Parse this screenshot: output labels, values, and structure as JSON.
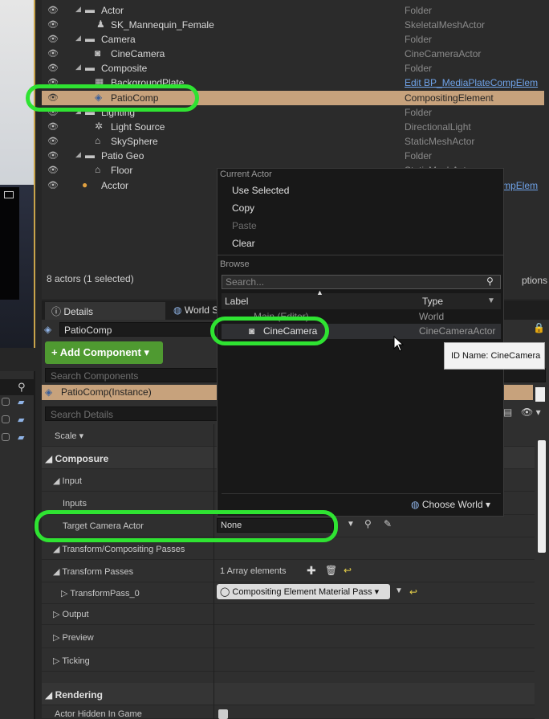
{
  "outliner": {
    "rows": [
      {
        "label": "Actor",
        "type": "Folder"
      },
      {
        "label": "SK_Mannequin_Female",
        "type": "SkeletalMeshActor"
      },
      {
        "label": "Camera",
        "type": "Folder"
      },
      {
        "label": "CineCamera",
        "type": "CineCameraActor"
      },
      {
        "label": "Composite",
        "type": "Folder"
      },
      {
        "label": "BackgroundPlate",
        "type": "Edit BP_MediaPlateCompElem"
      },
      {
        "label": "PatioComp",
        "type": "CompositingElement"
      },
      {
        "label": "Lighting",
        "type": "Folder"
      },
      {
        "label": "Light Source",
        "type": "DirectionalLight"
      },
      {
        "label": "SkySphere",
        "type": "StaticMeshActor"
      },
      {
        "label": "Patio Geo",
        "type": "Folder"
      },
      {
        "label": "Floor",
        "type": "StaticMeshActor"
      },
      {
        "label": "Acctor",
        "type": "Edit BP_MediaPlateCompElem"
      }
    ],
    "footer": "8 actors (1 selected)",
    "view_options": "ptions"
  },
  "tabs": {
    "details": "Details",
    "world": "World S"
  },
  "details": {
    "selected_name": "PatioComp",
    "add_component": "+ Add Component",
    "search_components": "Search Components",
    "instance": "PatioComp(Instance)",
    "search_details": "Search Details",
    "scale": "Scale",
    "composure": "Composure",
    "input": "Input",
    "inputs": "Inputs",
    "target_camera_actor": "Target Camera Actor",
    "target_value": "None",
    "transform_passes_header": "Transform/Compositing Passes",
    "transform_passes": "Transform Passes",
    "array_elements": "1 Array elements",
    "transform_pass_0": "TransformPass_0",
    "material_pass": "Compositing Element Material Pass",
    "output": "Output",
    "preview": "Preview",
    "ticking": "Ticking",
    "rendering": "Rendering",
    "actor_hidden": "Actor Hidden In Game"
  },
  "popup": {
    "current_actor": "Current Actor",
    "use_selected": "Use Selected",
    "copy": "Copy",
    "paste": "Paste",
    "clear": "Clear",
    "browse": "Browse",
    "search_placeholder": "Search...",
    "col_label": "Label",
    "col_type": "Type",
    "world_label": "Main (Editor)",
    "world_type": "World",
    "cam_label": "CineCamera",
    "cam_type": "CineCameraActor",
    "choose_world": "Choose World"
  },
  "tooltip": "ID Name: CineCamera",
  "colors": {
    "accent_green": "#2fe332",
    "selection": "#c7a27c",
    "add_button": "#4f9a31"
  }
}
